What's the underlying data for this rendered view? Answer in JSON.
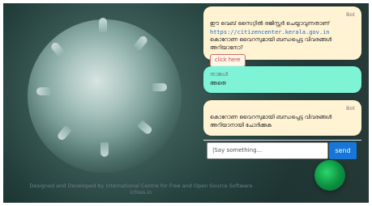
{
  "chat": {
    "bot_label": "Bot",
    "user_label": "താങ്കൾ",
    "messages": [
      {
        "sender": "Bot",
        "text_line1": "ഈ വെബ് സൈറ്റിൽ രജിസ്റ്റർ ചെയ്യാവുന്നതാണ്",
        "link": "https://citizencenter.kerala.gov.in",
        "text_line2": "കൊറോണ വൈറസുമായി ബന്ധപ്പെട്ട വിവരങ്ങൾ അറിയാനോ?",
        "button_label": "click here"
      },
      {
        "sender": "താങ്കൾ",
        "text": "അതെ"
      },
      {
        "sender": "Bot",
        "text": "കൊറോണ വൈറസുമായി ബന്ധപ്പെട്ട വിവരങ്ങൾ അറിയാനായി ചോദിക്കുക"
      }
    ]
  },
  "input": {
    "placeholder": "|Say something...",
    "send_label": "send"
  },
  "footer": {
    "line1": "Designed and Developed by International Centre for Free and Open Source Software",
    "line2": "icfoss.in"
  },
  "colors": {
    "bot_bubble": "#fff3d3",
    "user_bubble": "#7ef3d6",
    "send_button": "#1677d9",
    "fab": "#16a34a"
  }
}
